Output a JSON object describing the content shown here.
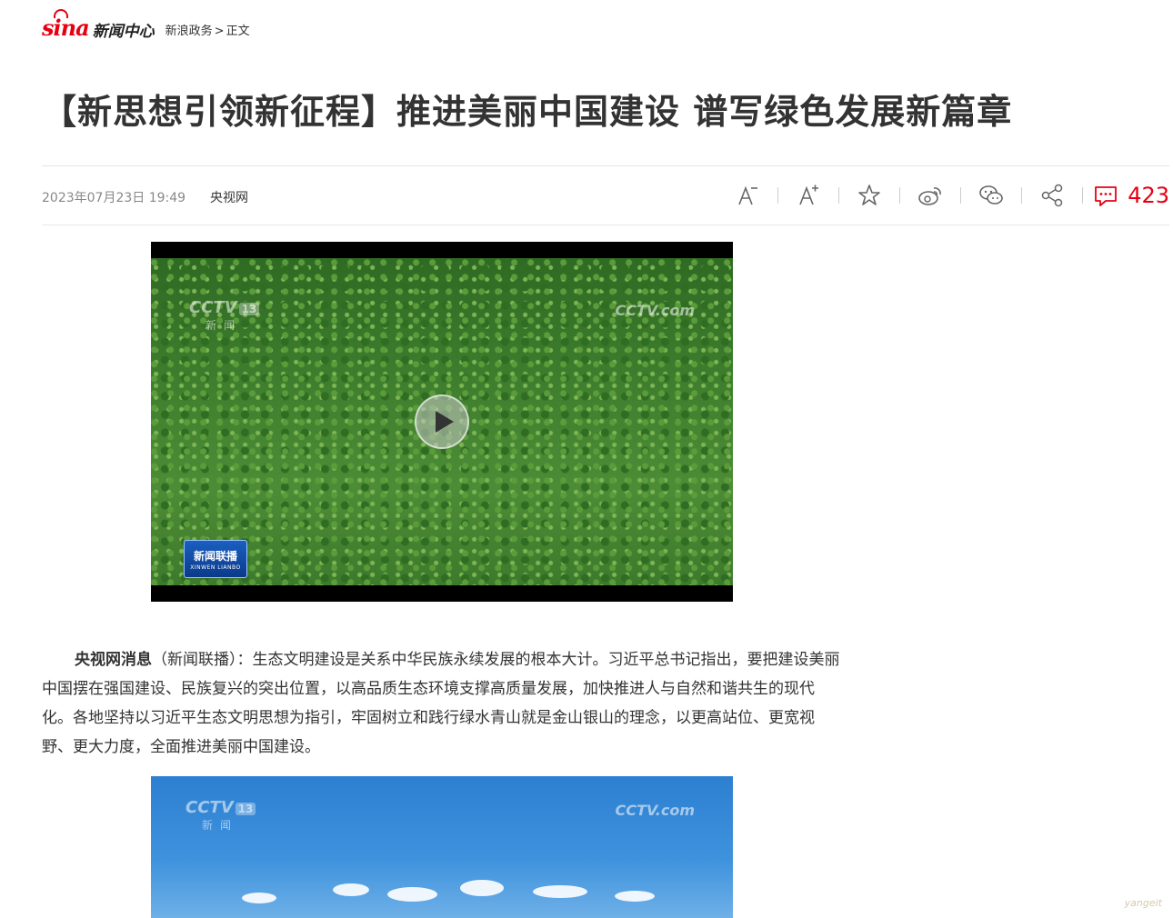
{
  "header": {
    "logo_text": "sina",
    "site_name": "新闻中心",
    "breadcrumb": [
      "新浪政务",
      "正文"
    ],
    "breadcrumb_sep": ">"
  },
  "article": {
    "title": "【新思想引领新征程】推进美丽中国建设 谱写绿色发展新篇章",
    "date": "2023年07月23日 19:49",
    "source": "央视网",
    "comment_count": "423",
    "lead_bold": "央视网消息",
    "lead_rest": "（新闻联播）：生态文明建设是关系中华民族永续发展的根本大计。习近平总书记指出，要把建设美丽中国摆在强国建设、民族复兴的突出位置，以高品质生态环境支撑高质量发展，加快推进人与自然和谐共生的现代化。各地坚持以习近平生态文明思想为指引，牢固树立和践行绿水青山就是金山银山的理念，以更高站位、更宽视野、更大力度，全面推进美丽中国建设。"
  },
  "media": {
    "watermark_cctv": "CCTV",
    "watermark_channel": "13",
    "watermark_sub": "新闻",
    "watermark_com": "CCTV.com",
    "program_logo": "新闻联播",
    "program_logo_en": "XINWEN LIANBO"
  },
  "tools": [
    "font-decrease-icon",
    "font-increase-icon",
    "star-icon",
    "weibo-icon",
    "wechat-icon",
    "share-icon",
    "comment-icon"
  ],
  "watermark_corner": "yangeit",
  "colors": {
    "accent": "#e60012",
    "text": "#333333",
    "muted": "#888888"
  }
}
